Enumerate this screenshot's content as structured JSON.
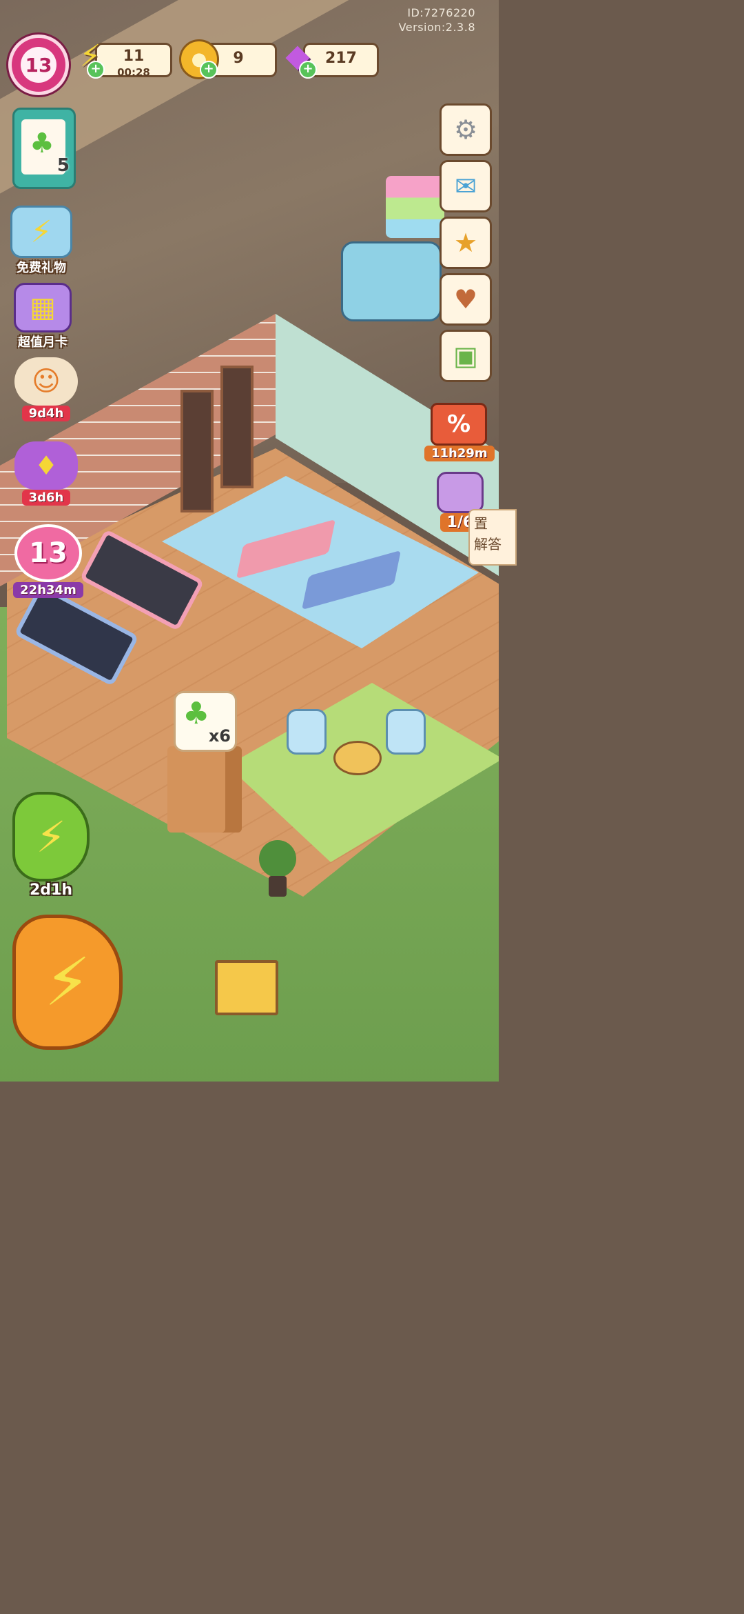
{
  "account": {
    "id_text": "ID:7276220",
    "version_text": "Version:2.3.8"
  },
  "player": {
    "level": "13"
  },
  "resources": {
    "energy": {
      "value": "11",
      "timer": "00:28"
    },
    "coins": {
      "value": "9"
    },
    "gems": {
      "value": "217"
    }
  },
  "task_board": {
    "count": "5"
  },
  "left_menu": {
    "free_gift": {
      "label": "免费礼物"
    },
    "monthly_card": {
      "label": "超值月卡"
    },
    "chef_event": {
      "timer": "9d4h"
    },
    "gem_event": {
      "timer": "3d6h"
    },
    "level_event": {
      "level": "13",
      "timer": "22h34m"
    }
  },
  "right_menu": {
    "sale": {
      "symbol": "%",
      "timer": "11h29m"
    },
    "jar": {
      "progress": "1/6"
    },
    "side_tab": {
      "label": "置\n解答"
    }
  },
  "reward_bubble": {
    "multiplier": "x6"
  },
  "boosts": {
    "small": {
      "timer": "2d1h"
    }
  },
  "icons": {
    "energy": "lightning-icon",
    "coins": "coin-icon",
    "gems": "gem-icon",
    "settings": "gear-icon",
    "mail": "mail-icon",
    "achievements": "medal-icon",
    "book": "heart-book-icon",
    "album": "duck-album-icon"
  },
  "colors": {
    "accent_pink": "#d8377e",
    "resource_bar": "#fff5dc",
    "plus_green": "#58c35a"
  }
}
